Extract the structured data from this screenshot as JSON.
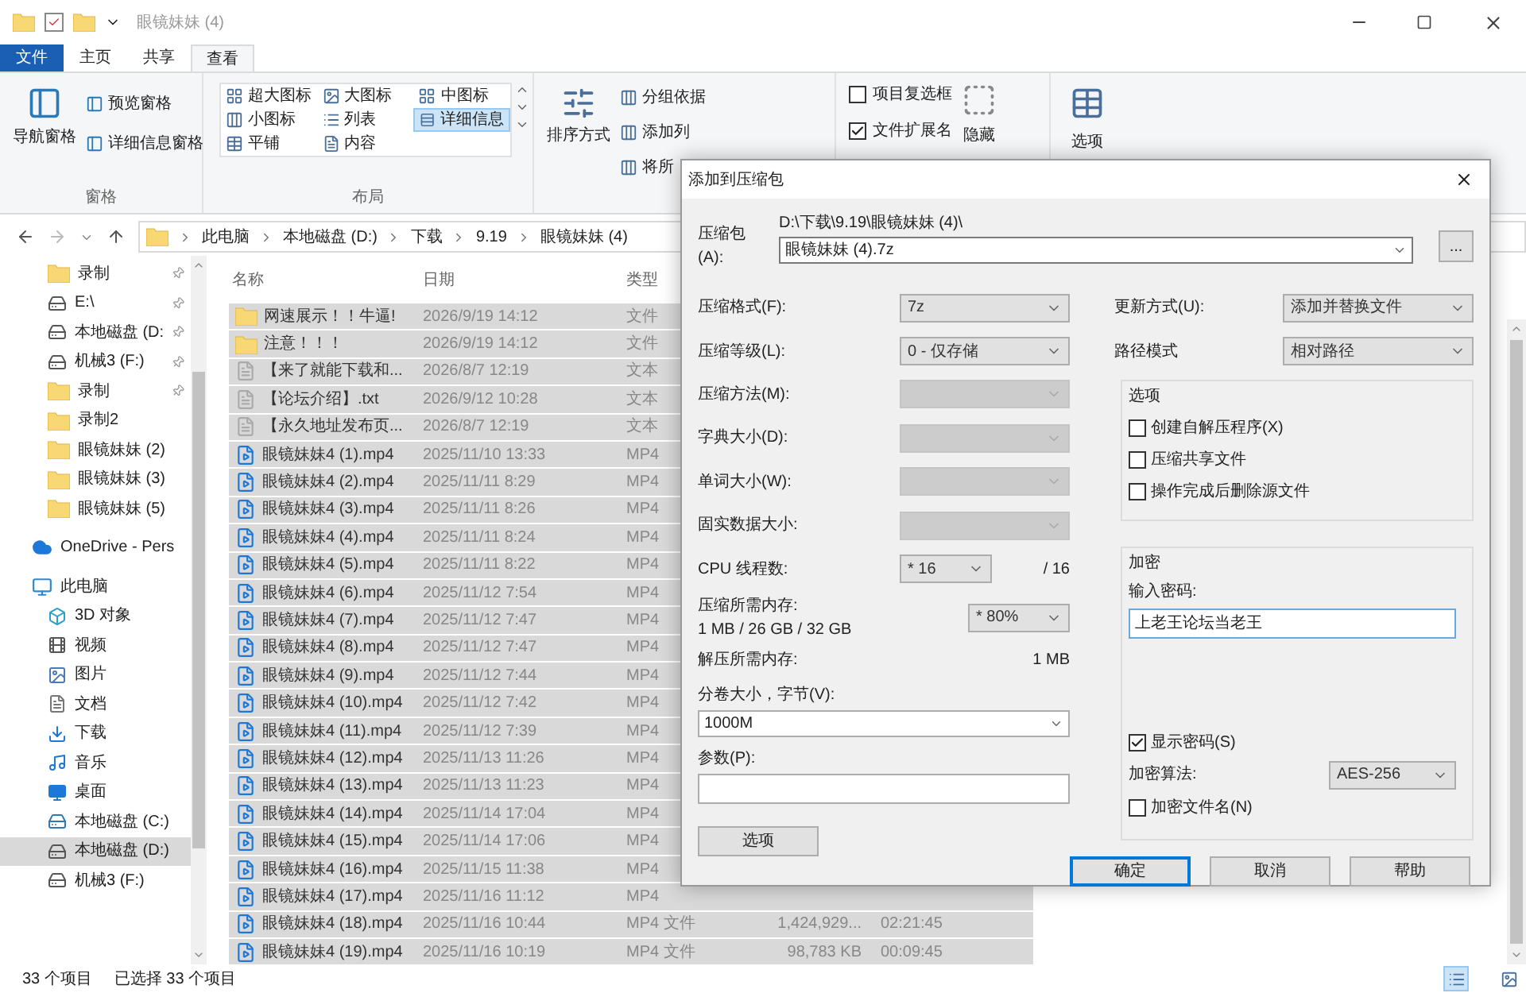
{
  "window": {
    "title": "眼镜妹妹 (4)"
  },
  "ribbon": {
    "tabs": [
      {
        "label": "文件",
        "kind": "file",
        "selected": false
      },
      {
        "label": "主页",
        "kind": "normal",
        "selected": false
      },
      {
        "label": "共享",
        "kind": "normal",
        "selected": false
      },
      {
        "label": "查看",
        "kind": "normal",
        "selected": true
      }
    ],
    "panes": {
      "label": "窗格",
      "nav_pane": "导航窗格",
      "items": [
        "预览窗格",
        "详细信息窗格"
      ]
    },
    "layout": {
      "label": "布局",
      "items": [
        {
          "label": "超大图标",
          "selected": false
        },
        {
          "label": "大图标",
          "selected": false
        },
        {
          "label": "中图标",
          "selected": false
        },
        {
          "label": "小图标",
          "selected": false
        },
        {
          "label": "列表",
          "selected": false
        },
        {
          "label": "详细信息",
          "selected": true
        },
        {
          "label": "平铺",
          "selected": false
        },
        {
          "label": "内容",
          "selected": false
        }
      ]
    },
    "current_view": {
      "sort": "排序方式",
      "items": [
        "分组依据",
        "添加列",
        "将所"
      ]
    },
    "show_hide": {
      "checkboxes": [
        {
          "label": "项目复选框",
          "checked": false
        },
        {
          "label": "文件扩展名",
          "checked": true
        }
      ],
      "hide": "隐藏"
    },
    "options": "选项"
  },
  "address_bar": {
    "segments": [
      "此电脑",
      "本地磁盘 (D:)",
      "下载",
      "9.19",
      "眼镜妹妹 (4)"
    ]
  },
  "nav": {
    "pinned_items": [
      {
        "label": "录制",
        "kind": "folder",
        "pinned": true
      },
      {
        "label": "E:\\",
        "kind": "drive",
        "pinned": true
      },
      {
        "label": "本地磁盘 (D:",
        "kind": "drive",
        "pinned": true
      },
      {
        "label": "机械3 (F:)",
        "kind": "drive",
        "pinned": true
      },
      {
        "label": "录制",
        "kind": "folder",
        "pinned": true
      },
      {
        "label": "录制2",
        "kind": "folder",
        "pinned": false
      },
      {
        "label": "眼镜妹妹 (2)",
        "kind": "folder",
        "pinned": false
      },
      {
        "label": "眼镜妹妹 (3)",
        "kind": "folder",
        "pinned": false
      },
      {
        "label": "眼镜妹妹 (5)",
        "kind": "folder",
        "pinned": false
      }
    ],
    "items": [
      {
        "label": "OneDrive - Pers",
        "kind": "cloud",
        "selected": false
      },
      {
        "label": "此电脑",
        "kind": "pc",
        "selected": false,
        "children": [
          {
            "label": "3D 对象",
            "kind": "cube",
            "selected": false
          },
          {
            "label": "视频",
            "kind": "video",
            "selected": false
          },
          {
            "label": "图片",
            "kind": "picture",
            "selected": false
          },
          {
            "label": "文档",
            "kind": "document",
            "selected": false
          },
          {
            "label": "下载",
            "kind": "download",
            "selected": false
          },
          {
            "label": "音乐",
            "kind": "music",
            "selected": false
          },
          {
            "label": "桌面",
            "kind": "desktop",
            "selected": false
          },
          {
            "label": "本地磁盘 (C:)",
            "kind": "system_drive",
            "selected": false
          },
          {
            "label": "本地磁盘 (D:)",
            "kind": "drive",
            "selected": true
          },
          {
            "label": "机械3 (F:)",
            "kind": "drive",
            "selected": false
          }
        ]
      }
    ]
  },
  "file_list": {
    "columns": [
      "名称",
      "日期",
      "类型"
    ],
    "rows": [
      {
        "name": "网速展示！！牛逼!",
        "date": "2026/9/19 14:12",
        "type": "文件",
        "kind": "folder",
        "selected": true
      },
      {
        "name": "注意！！！",
        "date": "2026/9/19 14:12",
        "type": "文件",
        "kind": "folder",
        "selected": true
      },
      {
        "name": "【来了就能下载和...",
        "date": "2026/8/7 12:19",
        "type": "文本",
        "kind": "text",
        "selected": true
      },
      {
        "name": "【论坛介绍】.txt",
        "date": "2026/9/12 10:28",
        "type": "文本",
        "kind": "text",
        "selected": true
      },
      {
        "name": "【永久地址发布页...",
        "date": "2026/8/7 12:19",
        "type": "文本",
        "kind": "text",
        "selected": true
      },
      {
        "name": "眼镜妹妹4 (1).mp4",
        "date": "2025/11/10 13:33",
        "type": "MP4",
        "kind": "video",
        "selected": true
      },
      {
        "name": "眼镜妹妹4 (2).mp4",
        "date": "2025/11/11 8:29",
        "type": "MP4",
        "kind": "video",
        "selected": true
      },
      {
        "name": "眼镜妹妹4 (3).mp4",
        "date": "2025/11/11 8:26",
        "type": "MP4",
        "kind": "video",
        "selected": true
      },
      {
        "name": "眼镜妹妹4 (4).mp4",
        "date": "2025/11/11 8:24",
        "type": "MP4",
        "kind": "video",
        "selected": true
      },
      {
        "name": "眼镜妹妹4 (5).mp4",
        "date": "2025/11/11 8:22",
        "type": "MP4",
        "kind": "video",
        "selected": true
      },
      {
        "name": "眼镜妹妹4 (6).mp4",
        "date": "2025/11/12 7:54",
        "type": "MP4",
        "kind": "video",
        "selected": true
      },
      {
        "name": "眼镜妹妹4 (7).mp4",
        "date": "2025/11/12 7:47",
        "type": "MP4",
        "kind": "video",
        "selected": true
      },
      {
        "name": "眼镜妹妹4 (8).mp4",
        "date": "2025/11/12 7:47",
        "type": "MP4",
        "kind": "video",
        "selected": true
      },
      {
        "name": "眼镜妹妹4 (9).mp4",
        "date": "2025/11/12 7:44",
        "type": "MP4",
        "kind": "video",
        "selected": true
      },
      {
        "name": "眼镜妹妹4 (10).mp4",
        "date": "2025/11/12 7:42",
        "type": "MP4",
        "kind": "video",
        "selected": true
      },
      {
        "name": "眼镜妹妹4 (11).mp4",
        "date": "2025/11/12 7:39",
        "type": "MP4",
        "kind": "video",
        "selected": true
      },
      {
        "name": "眼镜妹妹4 (12).mp4",
        "date": "2025/11/13 11:26",
        "type": "MP4",
        "kind": "video",
        "selected": true
      },
      {
        "name": "眼镜妹妹4 (13).mp4",
        "date": "2025/11/13 11:23",
        "type": "MP4",
        "kind": "video",
        "selected": true
      },
      {
        "name": "眼镜妹妹4 (14).mp4",
        "date": "2025/11/14 17:04",
        "type": "MP4",
        "kind": "video",
        "selected": true
      },
      {
        "name": "眼镜妹妹4 (15).mp4",
        "date": "2025/11/14 17:06",
        "type": "MP4",
        "kind": "video",
        "selected": true
      },
      {
        "name": "眼镜妹妹4 (16).mp4",
        "date": "2025/11/15 11:38",
        "type": "MP4",
        "kind": "video",
        "selected": true
      },
      {
        "name": "眼镜妹妹4 (17).mp4",
        "date": "2025/11/16 11:12",
        "type": "MP4",
        "kind": "video",
        "selected": true
      },
      {
        "name": "眼镜妹妹4 (18).mp4",
        "date": "2025/11/16 10:44",
        "type": "MP4 文件",
        "size": "1,424,929...",
        "duration": "02:21:45",
        "kind": "video",
        "selected": true
      },
      {
        "name": "眼镜妹妹4 (19).mp4",
        "date": "2025/11/16 10:19",
        "type": "MP4 文件",
        "size": "98,783 KB",
        "duration": "00:09:45",
        "kind": "video",
        "selected": true
      }
    ]
  },
  "status_bar": {
    "count": "33 个项目",
    "selection": "已选择 33 个项目",
    "views": [
      {
        "kind": "details",
        "selected": true
      },
      {
        "kind": "thumbnails",
        "selected": false
      }
    ]
  },
  "dialog": {
    "title": "添加到压缩包",
    "archive_label": "压缩包(A):",
    "archive_path": "D:\\下载\\9.19\\眼镜妹妹 (4)\\",
    "archive_name": "眼镜妹妹 (4).7z",
    "browse": "...",
    "left_fields": [
      {
        "kind": "select",
        "label": "压缩格式(F):",
        "value": "7z",
        "disabled": false
      },
      {
        "kind": "select",
        "label": "压缩等级(L):",
        "value": "0 - 仅存储",
        "disabled": false
      },
      {
        "kind": "select",
        "label": "压缩方法(M):",
        "disabled": true
      },
      {
        "kind": "select",
        "label": "字典大小(D):",
        "disabled": true
      },
      {
        "kind": "select",
        "label": "单词大小(W):",
        "disabled": true
      },
      {
        "kind": "select",
        "label": "固实数据大小:",
        "disabled": true
      },
      {
        "kind": "threads",
        "label": "CPU 线程数:",
        "value": "* 16",
        "max": "/ 16"
      },
      {
        "kind": "memory",
        "label": "压缩所需内存:",
        "detail": "1 MB / 26 GB / 32 GB",
        "value": "* 80%"
      },
      {
        "kind": "readout",
        "label": "解压所需内存:",
        "value": "1 MB"
      },
      {
        "kind": "combo",
        "label": "分卷大小，字节(V):",
        "value": "1000M"
      },
      {
        "kind": "input",
        "label": "参数(P):"
      }
    ],
    "options_button": "选项",
    "update_label": "更新方式(U):",
    "update_value": "添加并替换文件",
    "path_label": "路径模式",
    "path_value": "相对路径",
    "options_group": {
      "label": "选项",
      "checkboxes": [
        {
          "label": "创建自解压程序(X)",
          "checked": false
        },
        {
          "label": "压缩共享文件",
          "checked": false
        },
        {
          "label": "操作完成后删除源文件",
          "checked": false
        }
      ]
    },
    "encryption": {
      "label": "加密",
      "password_label": "输入密码:",
      "password": "上老王论坛当老王",
      "show_password": {
        "label": "显示密码(S)",
        "checked": true
      },
      "method_label": "加密算法:",
      "method": "AES-256",
      "encrypt_names": {
        "label": "加密文件名(N)",
        "checked": false
      }
    },
    "buttons": [
      {
        "label": "确定",
        "default": true
      },
      {
        "label": "取消",
        "default": false
      },
      {
        "label": "帮助",
        "default": false
      }
    ]
  }
}
